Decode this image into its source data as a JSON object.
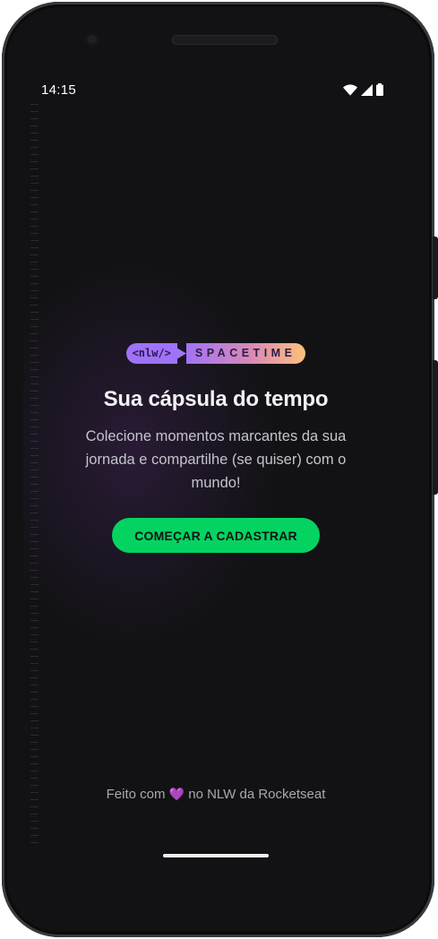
{
  "status_bar": {
    "time": "14:15",
    "icons": [
      "wifi-icon",
      "cellular-signal-icon",
      "battery-icon"
    ]
  },
  "brand": {
    "tag": "<nlw/>",
    "word": "SPACETIME",
    "colors": {
      "tag": "#9f72f7",
      "gradient_start": "#a173f5",
      "gradient_end": "#ffc07b"
    }
  },
  "hero": {
    "title": "Sua cápsula do tempo",
    "description": "Colecione momentos marcantes da sua jornada e compartilhe (se quiser) com o mundo!",
    "button_label": "COMEÇAR A CADASTRAR",
    "button_color": "#04d361"
  },
  "footer": {
    "prefix": "Feito com",
    "heart": "💜",
    "suffix": "no NLW da Rocketseat"
  }
}
